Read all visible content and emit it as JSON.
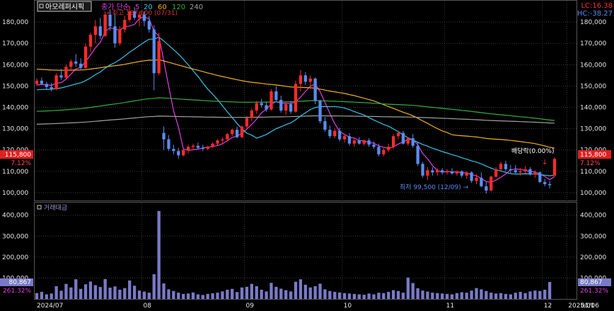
{
  "stock_name": "아모레퍼시픽",
  "legend": {
    "prefix": "종가 단순",
    "periods": [
      {
        "label": "5",
        "color": "#e040e0"
      },
      {
        "label": "20",
        "color": "#35c4e8"
      },
      {
        "label": "60",
        "color": "#f0b020"
      },
      {
        "label": "120",
        "color": "#30b040"
      },
      {
        "label": "240",
        "color": "#a0a0a0"
      }
    ]
  },
  "top_right": {
    "lc": "LC:16.38",
    "hc": "HC:-38.27"
  },
  "annotations": {
    "high": "최고 187,600 (07/31)",
    "low": "최저 99,500 (12/09)",
    "ex_dividend": "배당락(0.00%)"
  },
  "current_price_label": "115,800",
  "current_change_label": "7.12%",
  "volume_title": "거래대금",
  "current_volume_label": "80,867",
  "current_volume_pct_label": "261.32%",
  "colors": {
    "up": "#ff2b2b",
    "down": "#5b8cf0",
    "price_tag": "#e02020",
    "volume_bar": "#7a7ac8",
    "grid": "#3a3a3a"
  },
  "chart_data": [
    {
      "type": "candlestick",
      "title": "아모레퍼시픽",
      "x_tick_labels": [
        "2024/07",
        "08",
        "09",
        "10",
        "11",
        "12",
        "2025/01",
        "01/06"
      ],
      "y_tick_labels": [
        "100,000",
        "110,000",
        "120,000",
        "130,000",
        "140,000",
        "150,000",
        "160,000",
        "170,000",
        "180,000"
      ],
      "ylim": [
        96000,
        190000
      ],
      "grid": true,
      "candles": [
        [
          151000,
          153500,
          150000,
          152500
        ],
        [
          152500,
          154000,
          150500,
          151000
        ],
        [
          151000,
          152000,
          148500,
          149500
        ],
        [
          149500,
          151500,
          147500,
          148500
        ],
        [
          148500,
          156000,
          148000,
          155000
        ],
        [
          155000,
          158000,
          153000,
          154000
        ],
        [
          154000,
          160000,
          153500,
          159000
        ],
        [
          159000,
          162500,
          157000,
          161500
        ],
        [
          161500,
          165000,
          159000,
          160500
        ],
        [
          160500,
          163000,
          157500,
          158500
        ],
        [
          158500,
          170000,
          158000,
          168500
        ],
        [
          168500,
          175000,
          166000,
          174000
        ],
        [
          174000,
          181000,
          170000,
          178000
        ],
        [
          178000,
          182000,
          172000,
          173500
        ],
        [
          173500,
          185000,
          173000,
          183500
        ],
        [
          183500,
          186000,
          176000,
          178000
        ],
        [
          178000,
          184000,
          168000,
          170000
        ],
        [
          170000,
          178000,
          169000,
          176500
        ],
        [
          176500,
          183000,
          175000,
          181000
        ],
        [
          181000,
          187600,
          180000,
          185000
        ],
        [
          185000,
          187000,
          181000,
          182000
        ],
        [
          182000,
          185000,
          178000,
          183500
        ],
        [
          183500,
          185000,
          178000,
          180500
        ],
        [
          180500,
          183000,
          175000,
          176500
        ],
        [
          176500,
          178500,
          148000,
          156000
        ],
        [
          156000,
          175000,
          155000,
          171000
        ],
        [
          128000,
          131000,
          120000,
          125000
        ],
        [
          125000,
          127000,
          119500,
          120500
        ],
        [
          120500,
          122500,
          118000,
          119500
        ],
        [
          119500,
          121000,
          116000,
          117500
        ],
        [
          117500,
          121000,
          117000,
          120000
        ],
        [
          120000,
          122500,
          118500,
          121500
        ],
        [
          121500,
          123000,
          120000,
          122000
        ],
        [
          122000,
          123500,
          120500,
          121000
        ],
        [
          121000,
          122500,
          119500,
          120500
        ],
        [
          120500,
          122000,
          120000,
          121500
        ],
        [
          121500,
          123500,
          121000,
          123000
        ],
        [
          123000,
          125000,
          122000,
          124500
        ],
        [
          124500,
          126000,
          123000,
          125000
        ],
        [
          125000,
          128000,
          124000,
          127500
        ],
        [
          127500,
          130000,
          126500,
          129500
        ],
        [
          129500,
          131000,
          125500,
          126000
        ],
        [
          126000,
          131500,
          125500,
          131000
        ],
        [
          131000,
          136000,
          130000,
          135000
        ],
        [
          135000,
          139500,
          133500,
          138500
        ],
        [
          138500,
          143000,
          137000,
          142000
        ],
        [
          142000,
          144000,
          140000,
          141000
        ],
        [
          141000,
          142500,
          138000,
          139000
        ],
        [
          139000,
          148500,
          138500,
          147500
        ],
        [
          147500,
          150000,
          142500,
          143500
        ],
        [
          143500,
          145500,
          137500,
          138500
        ],
        [
          138500,
          142000,
          136500,
          141500
        ],
        [
          141500,
          143000,
          137000,
          138000
        ],
        [
          138000,
          152500,
          137500,
          151000
        ],
        [
          151000,
          157500,
          147500,
          155000
        ],
        [
          155000,
          156500,
          150500,
          152000
        ],
        [
          152000,
          155000,
          148500,
          153500
        ],
        [
          153500,
          154000,
          141500,
          143000
        ],
        [
          143000,
          143500,
          132500,
          133500
        ],
        [
          133500,
          135500,
          128500,
          129500
        ],
        [
          129500,
          131500,
          125500,
          126500
        ],
        [
          126500,
          130000,
          125500,
          129000
        ],
        [
          129000,
          130500,
          124000,
          125000
        ],
        [
          125000,
          127500,
          123500,
          126500
        ],
        [
          126500,
          128000,
          122000,
          123000
        ],
        [
          123000,
          125500,
          121500,
          124500
        ],
        [
          124500,
          126000,
          122500,
          123000
        ],
        [
          123000,
          125000,
          122000,
          124500
        ],
        [
          124500,
          125500,
          121500,
          122500
        ],
        [
          122500,
          124000,
          120500,
          121500
        ],
        [
          121500,
          123000,
          117000,
          118000
        ],
        [
          118000,
          121000,
          117000,
          120000
        ],
        [
          120000,
          123000,
          119000,
          121500
        ],
        [
          121500,
          127500,
          120500,
          126500
        ],
        [
          126500,
          129000,
          125000,
          128000
        ],
        [
          128000,
          129000,
          122500,
          123000
        ],
        [
          123000,
          126000,
          122000,
          125500
        ],
        [
          125500,
          127500,
          121000,
          122000
        ],
        [
          122000,
          123500,
          112500,
          113500
        ],
        [
          113500,
          114500,
          107000,
          108000
        ],
        [
          108000,
          112000,
          106000,
          110500
        ],
        [
          110500,
          112000,
          108000,
          109500
        ],
        [
          109500,
          111500,
          108000,
          110500
        ],
        [
          110500,
          111500,
          108500,
          109500
        ],
        [
          109500,
          111000,
          108500,
          110000
        ],
        [
          110000,
          111500,
          108500,
          109000
        ],
        [
          109000,
          110500,
          108000,
          110000
        ],
        [
          110000,
          110500,
          107000,
          108000
        ],
        [
          108000,
          110000,
          106500,
          109500
        ],
        [
          109500,
          110000,
          104500,
          105500
        ],
        [
          105500,
          108500,
          104000,
          107000
        ],
        [
          107000,
          109500,
          102500,
          103000
        ],
        [
          103000,
          105000,
          99500,
          101000
        ],
        [
          101000,
          108000,
          100500,
          107500
        ],
        [
          107500,
          112000,
          107000,
          111000
        ],
        [
          111000,
          114500,
          110500,
          113500
        ],
        [
          113500,
          115000,
          110000,
          111000
        ],
        [
          111000,
          113000,
          109000,
          110500
        ],
        [
          110500,
          113000,
          108500,
          109500
        ],
        [
          109500,
          111500,
          108000,
          110000
        ],
        [
          110000,
          112500,
          109000,
          111000
        ],
        [
          111000,
          112000,
          108000,
          108500
        ],
        [
          108500,
          110500,
          107000,
          109500
        ],
        [
          109500,
          110000,
          104500,
          105000
        ],
        [
          105000,
          106500,
          103000,
          104000
        ],
        [
          104000,
          105500,
          102000,
          103500
        ],
        [
          108000,
          116500,
          107500,
          115800
        ]
      ],
      "volumes": [
        28,
        34,
        22,
        26,
        61,
        39,
        72,
        55,
        94,
        48,
        70,
        83,
        66,
        57,
        95,
        54,
        60,
        44,
        52,
        88,
        63,
        40,
        35,
        30,
        118,
        420,
        74,
        46,
        38,
        30,
        24,
        26,
        31,
        22,
        19,
        24,
        27,
        30,
        36,
        44,
        48,
        33,
        55,
        58,
        72,
        61,
        44,
        36,
        77,
        58,
        49,
        42,
        36,
        82,
        94,
        68,
        55,
        61,
        73,
        46,
        38,
        34,
        31,
        28,
        26,
        24,
        22,
        20,
        26,
        22,
        30,
        28,
        34,
        42,
        38,
        30,
        102,
        76,
        51,
        40,
        35,
        30,
        28,
        26,
        24,
        22,
        28,
        32,
        30,
        40,
        52,
        46,
        38,
        30,
        26,
        28,
        24,
        22,
        30,
        34,
        28,
        36,
        40,
        38,
        44,
        81
      ],
      "volume_ylim": [
        0,
        460000
      ],
      "volume_tick_labels": [
        "100,000",
        "200,000",
        "300,000",
        "400,000"
      ]
    }
  ]
}
